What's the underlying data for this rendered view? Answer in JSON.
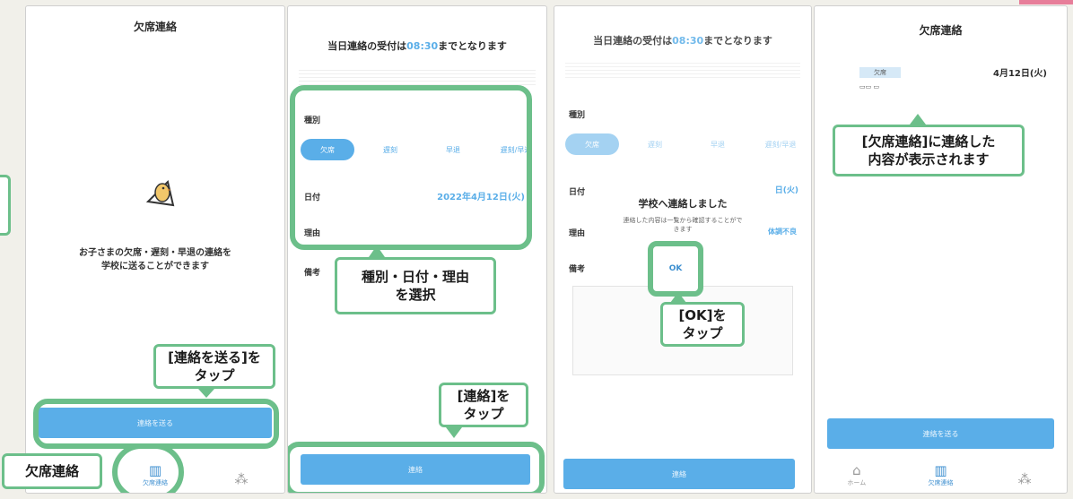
{
  "colors": {
    "accent": "#5aaee8",
    "callout": "#6cbf8a"
  },
  "screen1": {
    "title": "欠席連絡",
    "message_line1": "お子さまの欠席・遅刻・早退の連絡を",
    "message_line2": "学校に送ることができます",
    "send_button": "連絡を送る",
    "tabs": [
      "",
      "欠席連絡",
      ""
    ],
    "callout_send_line1": "[連絡を送る]を",
    "callout_send_line2": "タップ",
    "callout_tab": "欠席連絡"
  },
  "screen2": {
    "notice_prefix": "当日連絡の受付は",
    "notice_time": "08:30",
    "notice_suffix": "までとなります",
    "type_label": "種別",
    "types": [
      "欠席",
      "遅刻",
      "早退",
      "遅刻/早退"
    ],
    "date_label": "日付",
    "date_value": "2022年4月12日(火)",
    "reason_label": "理由",
    "remarks_label": "備考",
    "submit_button": "連絡",
    "callout_select_line1": "種別・日付・理由",
    "callout_select_line2": "を選択",
    "callout_submit_line1": "[連絡]を",
    "callout_submit_line2": "タップ"
  },
  "screen3": {
    "notice_prefix": "当日連絡の受付は",
    "notice_time": "08:30",
    "notice_suffix": "までとなります",
    "type_label": "種別",
    "types": [
      "欠席",
      "遅刻",
      "早退",
      "遅刻/早退"
    ],
    "date_label": "日付",
    "date_value": "日(火)",
    "reason_label": "理由",
    "reason_value": "体調不良",
    "remarks_label": "備考",
    "dialog_title": "学校へ連絡しました",
    "dialog_body_line1": "連絡した内容は一覧から確認することがで",
    "dialog_body_line2": "きます",
    "ok_label": "OK",
    "submit_button": "連絡",
    "callout_ok_line1": "[OK]を",
    "callout_ok_line2": "タップ"
  },
  "screen4": {
    "title": "欠席連絡",
    "badge": "欠席",
    "date": "4月12日(火)",
    "send_button": "連絡を送る",
    "tabs": [
      "ホーム",
      "欠席連絡",
      ""
    ],
    "callout_line1": "[欠席連絡]に連絡した",
    "callout_line2": "内容が表示されます"
  }
}
